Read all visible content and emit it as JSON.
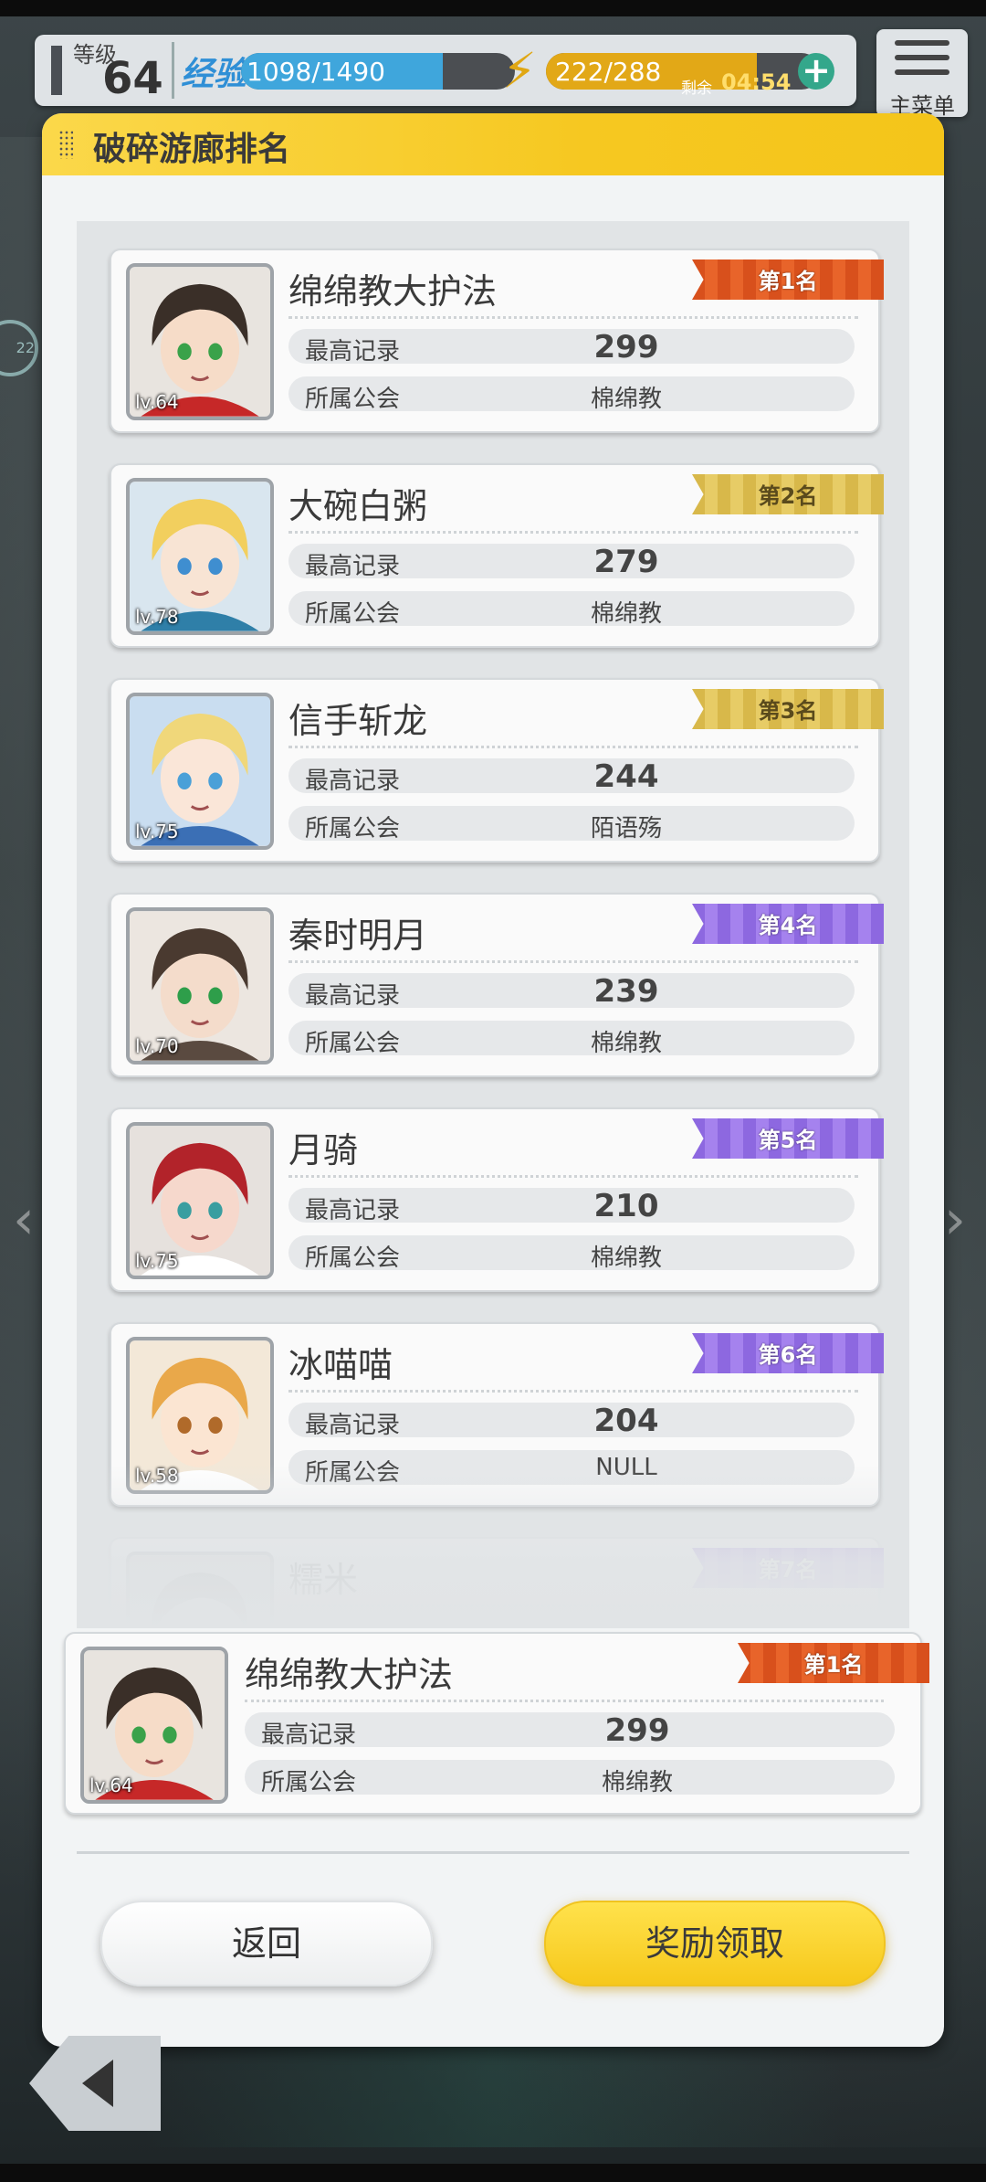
{
  "hud": {
    "level_label": "等级",
    "level": "64",
    "exp_label": "经验",
    "exp_text": "1098/1490",
    "exp_ratio": 0.737,
    "energy_text": "222/288",
    "energy_ratio": 0.771,
    "remain_label": "剩余",
    "remain_time": "04:54",
    "menu_label": "主菜单"
  },
  "panel": {
    "title": "破碎游廊排名",
    "record_label": "最高记录",
    "guild_label": "所属公会"
  },
  "ranking": [
    {
      "rank_label": "第1名",
      "name": "绵绵教大护法",
      "level": "lv.64",
      "record": "299",
      "guild": "棉绵教",
      "ribbon": "gold1"
    },
    {
      "rank_label": "第2名",
      "name": "大碗白粥",
      "level": "lv.78",
      "record": "279",
      "guild": "棉绵教",
      "ribbon": "gold"
    },
    {
      "rank_label": "第3名",
      "name": "信手斩龙",
      "level": "lv.75",
      "record": "244",
      "guild": "陌语殇",
      "ribbon": "gold"
    },
    {
      "rank_label": "第4名",
      "name": "秦时明月",
      "level": "lv.70",
      "record": "239",
      "guild": "棉绵教",
      "ribbon": "purple"
    },
    {
      "rank_label": "第5名",
      "name": "月骑",
      "level": "lv.75",
      "record": "210",
      "guild": "棉绵教",
      "ribbon": "purple"
    },
    {
      "rank_label": "第6名",
      "name": "冰喵喵",
      "level": "lv.58",
      "record": "204",
      "guild": "NULL",
      "ribbon": "purple"
    },
    {
      "rank_label": "第7名",
      "name": "糯米",
      "level": "",
      "record": "",
      "guild": "",
      "ribbon": "purple"
    }
  ],
  "my_rank": {
    "rank_label": "第1名",
    "name": "绵绵教大护法",
    "level": "lv.64",
    "record": "299",
    "guild": "棉绵教"
  },
  "buttons": {
    "back": "返回",
    "claim": "奖励领取"
  },
  "colors": {
    "header": "#f6c821",
    "exp": "#3fa6dc",
    "energy": "#e2a817",
    "rank1": "#d8501c",
    "rank_gold": "#d8b84a",
    "rank_purple": "#8d68e0"
  }
}
